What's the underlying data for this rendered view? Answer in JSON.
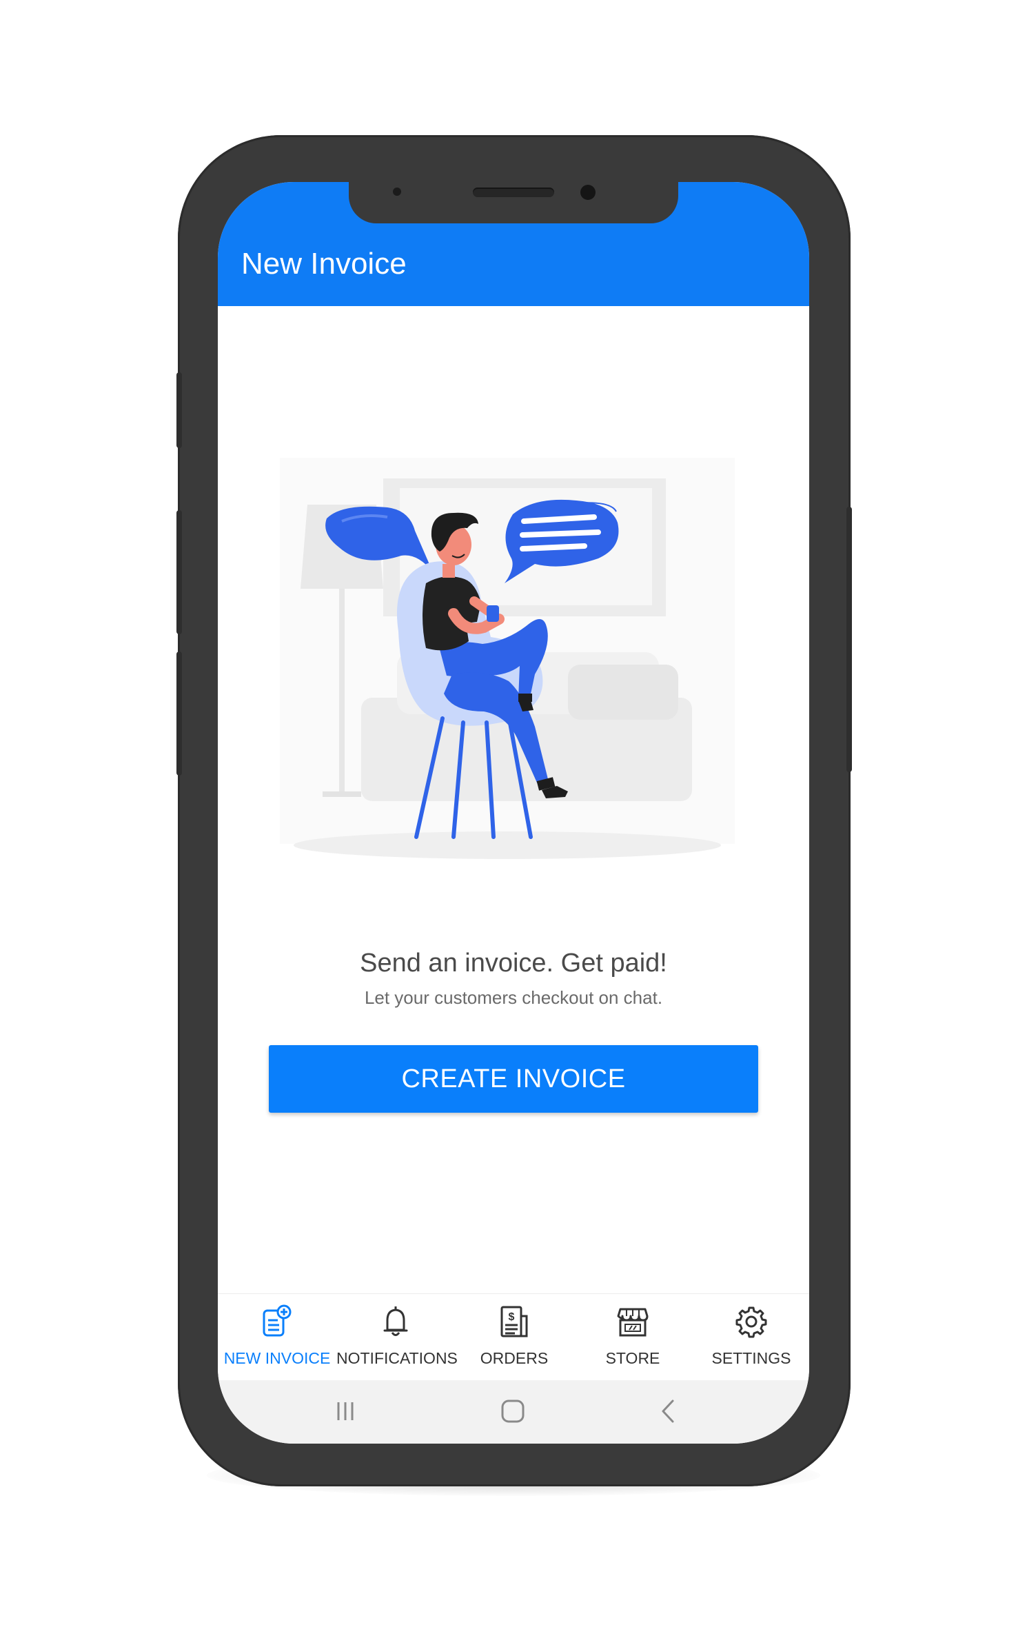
{
  "appbar": {
    "title": "New Invoice"
  },
  "empty_state": {
    "headline": "Send an invoice. Get paid!",
    "subline": "Let your customers checkout on chat.",
    "illustration_icon": "person-chatting-illustration"
  },
  "cta": {
    "label": "CREATE INVOICE"
  },
  "bottom_nav": {
    "items": [
      {
        "label": "NEW INVOICE",
        "icon": "new-invoice-icon",
        "active": true
      },
      {
        "label": "NOTIFICATIONS",
        "icon": "bell-icon",
        "active": false
      },
      {
        "label": "ORDERS",
        "icon": "orders-icon",
        "active": false
      },
      {
        "label": "STORE",
        "icon": "store-icon",
        "active": false
      },
      {
        "label": "SETTINGS",
        "icon": "gear-icon",
        "active": false
      }
    ]
  },
  "system_nav": {
    "buttons": [
      "recents-icon",
      "home-icon",
      "back-icon"
    ]
  },
  "colors": {
    "accent": "#0f7cf5",
    "button": "#0a7ffb",
    "phone_frame": "#3a3a3a",
    "illustration_blue": "#2f63e8",
    "illustration_light_blue": "#c9d8fb"
  }
}
